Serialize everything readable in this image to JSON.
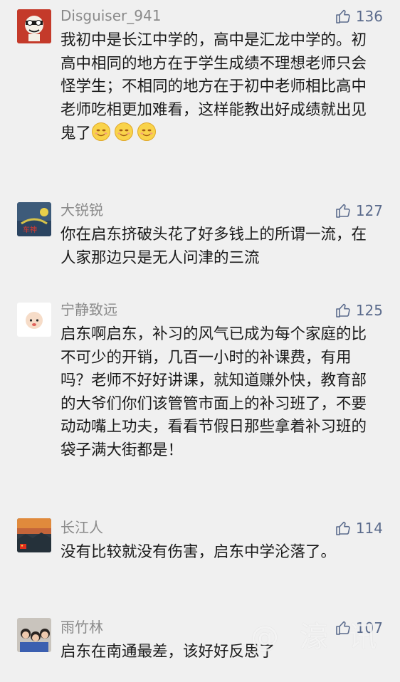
{
  "comments": [
    {
      "nickname": "Disguiser_941",
      "likes": "136",
      "text": "我初中是长江中学的，高中是汇龙中学的。初高中相同的地方在于学生成绩不理想老师只会怪学生；不相同的地方在于初中老师相比高中老师吃相更加难看，这样能教出好成绩就出见鬼了",
      "trailing_emoji": "smile-emoji",
      "trailing_emoji_count": 3
    },
    {
      "nickname": "大锐锐",
      "likes": "127",
      "text": "你在启东挤破头花了好多钱上的所谓一流，在人家那边只是无人问津的三流"
    },
    {
      "nickname": "宁静致远",
      "likes": "125",
      "text": "启东啊启东，补习的风气已成为每个家庭的比不可少的开销，几百一小时的补课费，有用吗？老师不好好讲课，就知道赚外快，教育部的大爷们你们该管管市面上的补习班了，不要动动嘴上功夫，看看节假日那些拿着补习班的袋子满大街都是！"
    },
    {
      "nickname": "长江人",
      "likes": "114",
      "text": "没有比较就没有伤害，启东中学沦落了。"
    },
    {
      "nickname": "雨竹林",
      "likes": "107",
      "text": "启东在南通最差，该好好反思了"
    }
  ],
  "watermark": "@ 濠 讯",
  "colors": {
    "background": "#f0f0f0",
    "nickname": "#8a8a8a",
    "like": "#5b6b8c",
    "text": "#1a1a1a"
  }
}
